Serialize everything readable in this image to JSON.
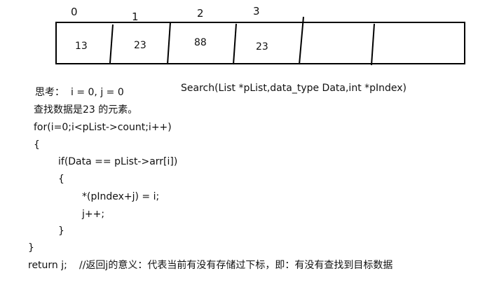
{
  "array": {
    "indices": [
      "0",
      "1",
      "2",
      "3"
    ],
    "values": [
      "13",
      "23",
      "88",
      "23"
    ]
  },
  "signature": "Search(List *pList,data_type Data,int *pIndex)",
  "thinking": {
    "label": "思考：",
    "init": "i = 0, j = 0"
  },
  "task": "查找数据是23 的元素。",
  "code": {
    "for_line": "for(i=0;i<pList->count;i++)",
    "open_brace_1": "{",
    "if_line": "if(Data == pList->arr[i])",
    "open_brace_2": "{",
    "assign_line": "*(pIndex+j) = i;",
    "increment_line": "j++;",
    "close_brace_2": "}",
    "close_brace_1": "}",
    "return_line": "return j;",
    "comment": "//返回j的意义：代表当前有没有存储过下标，即：有没有查找到目标数据"
  }
}
